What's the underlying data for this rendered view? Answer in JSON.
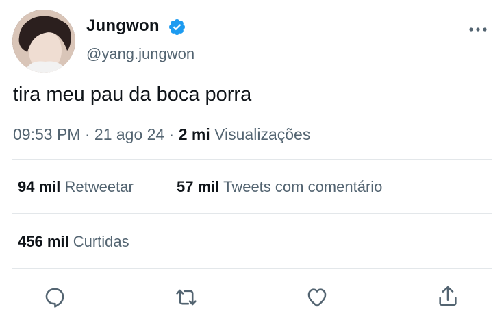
{
  "user": {
    "display_name": "Jungwon",
    "handle": "@yang.jungwon",
    "verified_icon": "verified-badge-icon",
    "avatar_icon": "avatar"
  },
  "tweet": {
    "text": "tira meu pau da boca porra",
    "time": "09:53 PM",
    "separator": "·",
    "date": "21 ago 24",
    "views_count": "2 mi",
    "views_label": "Visualizações"
  },
  "stats": {
    "retweets_count": "94 mil",
    "retweets_label": "Retweetar",
    "quotes_count": "57 mil",
    "quotes_label": "Tweets com comentário",
    "likes_count": "456 mil",
    "likes_label": "Curtidas"
  },
  "actions": {
    "reply_icon": "reply-icon",
    "retweet_icon": "retweet-icon",
    "like_icon": "heart-icon",
    "share_icon": "share-icon"
  },
  "colors": {
    "accent": "#1d9bf0",
    "secondary_text": "#536471",
    "primary_text": "#0f1419",
    "divider": "#e3e7ea"
  }
}
